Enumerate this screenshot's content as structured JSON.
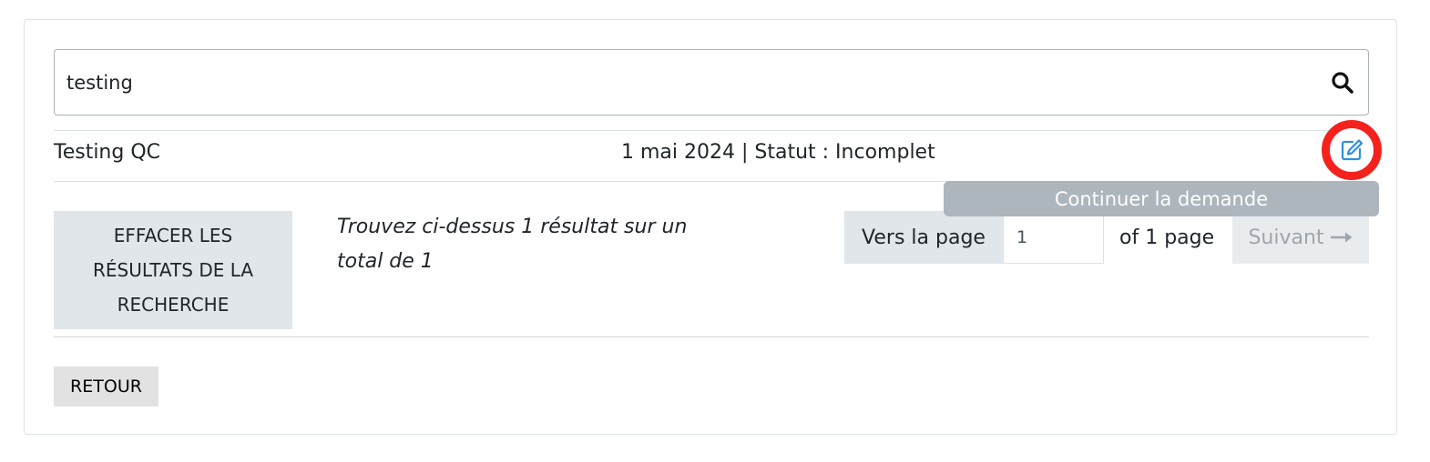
{
  "search": {
    "value": "testing",
    "button_icon": "search-icon"
  },
  "result": {
    "name": "Testing QC",
    "meta": "1 mai 2024 | Statut : Incomplet",
    "edit_icon": "edit-icon",
    "tooltip": "Continuer la demande"
  },
  "actions": {
    "clear_label": "EFFACER LES RÉSULTATS DE LA RECHERCHE"
  },
  "summary": "Trouvez ci-dessus 1 résultat sur un total de 1",
  "pagination": {
    "label": "Vers la page",
    "current_page": "1",
    "total_text": "of 1 page",
    "next_label": "Suivant",
    "next_icon": "arrow-right-icon"
  },
  "footer": {
    "back_label": "RETOUR"
  },
  "colors": {
    "edit_icon": "#2e8fdb",
    "highlight_ring": "#f5211d",
    "tooltip_bg": "#adb5bd",
    "button_bg": "#e1e6ea"
  }
}
